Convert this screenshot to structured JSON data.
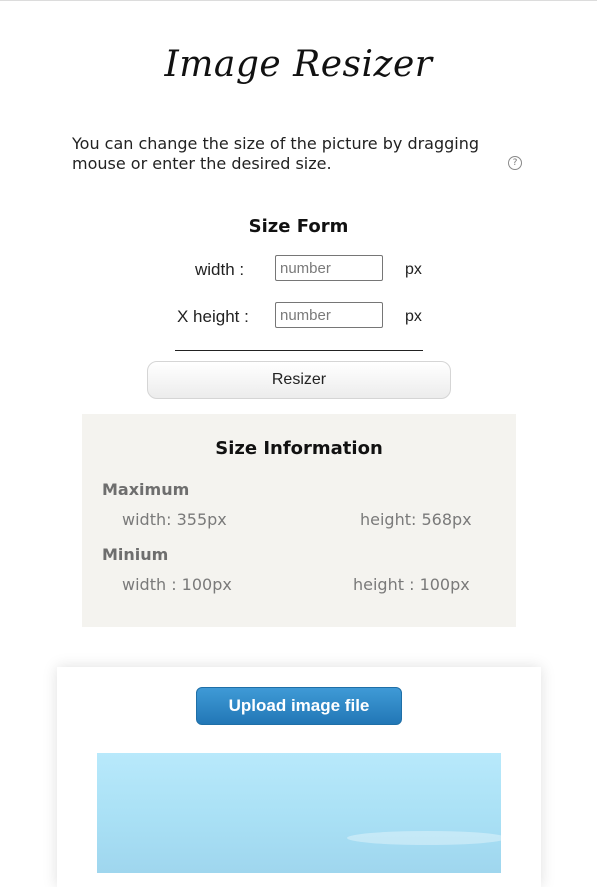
{
  "title": "Image Resizer",
  "intro": "You can change the size of the picture by dragging mouse or enter the desired size.",
  "help_icon": "?",
  "size_form": {
    "title": "Size Form",
    "width_label": "width  :",
    "width_placeholder": "number",
    "width_unit": "px",
    "height_label": "X height :",
    "height_placeholder": "number",
    "height_unit": "px",
    "resize_button": "Resizer"
  },
  "size_info": {
    "title": "Size Information",
    "maximum_label": "Maximum",
    "max_width": "width:  355px",
    "max_height": "height:  568px",
    "minimum_label": "Minium",
    "min_width": "width :  100px",
    "min_height": "height :  100px"
  },
  "upload": {
    "button_label": "Upload image file"
  }
}
